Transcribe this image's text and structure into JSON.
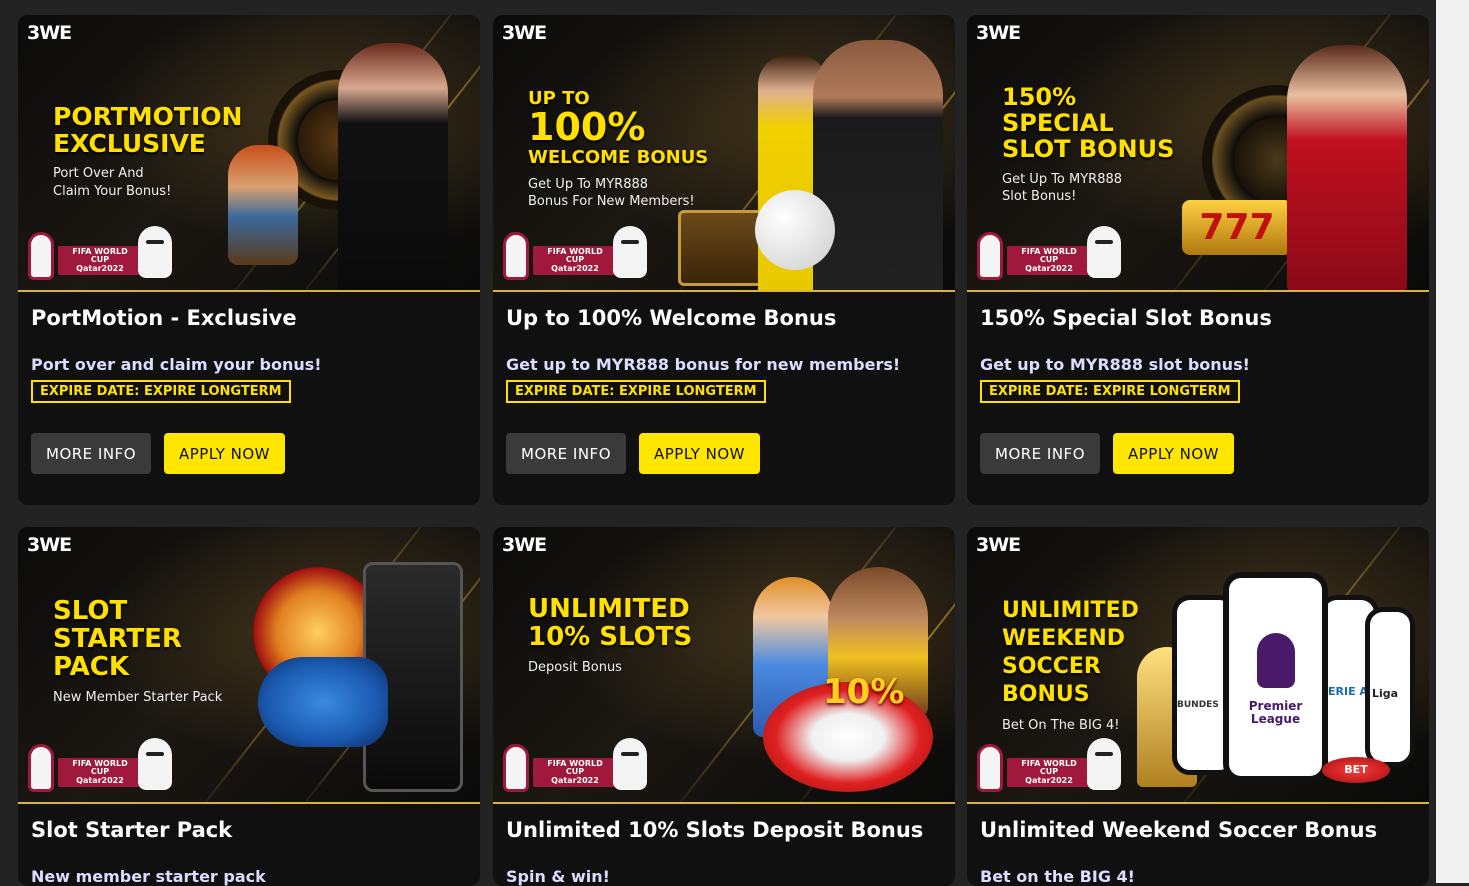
{
  "brand": "3WE",
  "fifa_tag": "FIFA WORLD CUP\nQatar2022",
  "colors": {
    "accent": "#ffe000",
    "card_bg": "#101010",
    "page_bg": "#232323",
    "more_btn": "#3a3a3a"
  },
  "cards": [
    {
      "headline": "PORTMOTION\nEXCLUSIVE",
      "sub": "Port Over And\nClaim Your Bonus!",
      "title": "PortMotion - Exclusive",
      "desc": "Port over and claim your bonus!",
      "expire": "EXPIRE DATE: EXPIRE LONGTERM",
      "more_label": "MORE INFO",
      "apply_label": "APPLY NOW"
    },
    {
      "headline_pre": "UP TO",
      "headline": "100%",
      "headline_post": "WELCOME BONUS",
      "sub": "Get Up To MYR888\nBonus For New Members!",
      "title": "Up to 100% Welcome Bonus",
      "desc": "Get up to MYR888 bonus for new members!",
      "expire": "EXPIRE DATE: EXPIRE LONGTERM",
      "more_label": "MORE INFO",
      "apply_label": "APPLY NOW"
    },
    {
      "headline": "150%\nSPECIAL\nSLOT BONUS",
      "sub": "Get Up To MYR888\nSlot Bonus!",
      "title": "150% Special Slot Bonus",
      "desc": "Get up to MYR888 slot bonus!",
      "expire": "EXPIRE DATE: EXPIRE LONGTERM",
      "more_label": "MORE INFO",
      "apply_label": "APPLY NOW"
    },
    {
      "headline": "SLOT\nSTARTER\nPACK",
      "sub": "New Member Starter Pack",
      "title": "Slot Starter Pack",
      "desc": "New member starter pack"
    },
    {
      "headline": "UNLIMITED\n10% SLOTS",
      "sub": "Deposit Bonus",
      "badge": "10%",
      "title": "Unlimited 10% Slots Deposit Bonus",
      "desc": "Spin & win!"
    },
    {
      "headline": "UNLIMITED\nWEEKEND\nSOCCER\nBONUS",
      "sub": "Bet On The BIG 4!",
      "league_center": "Premier\nLeague",
      "league_left": "BUNDES",
      "league_right1": "ERIE A",
      "league_right2": "Liga",
      "bet_button": "BET",
      "title": "Unlimited Weekend Soccer Bonus",
      "desc": "Bet on the BIG 4!"
    }
  ]
}
